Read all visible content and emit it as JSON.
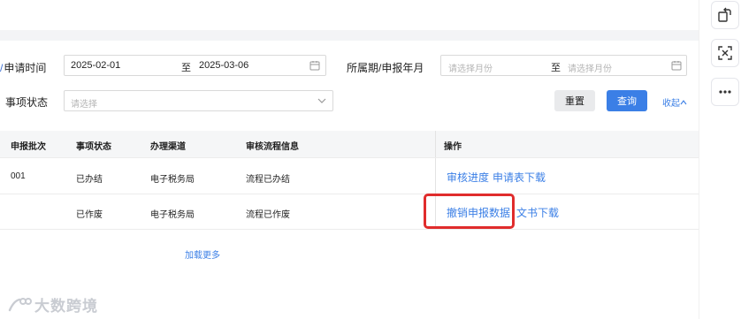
{
  "filters": {
    "apply_time": {
      "label": "申请时间",
      "start": "2025-02-01",
      "separator": "至",
      "end": "2025-03-06"
    },
    "period": {
      "label": "所属期/申报年月",
      "start_placeholder": "请选择月份",
      "separator": "至",
      "end_placeholder": "请选择月份"
    },
    "status": {
      "label": "事项状态",
      "placeholder": "请选择"
    },
    "reset_label": "重置",
    "query_label": "查询",
    "collapse_label": "收起"
  },
  "table": {
    "headers": [
      "申报批次",
      "事项状态",
      "办理渠道",
      "审核流程信息",
      "操作"
    ],
    "rows": [
      {
        "batch": "001",
        "status": "已办结",
        "channel": "电子税务局",
        "flow": "流程已办结",
        "actions": [
          "审核进度",
          "申请表下载"
        ]
      },
      {
        "batch": "",
        "status": "已作废",
        "channel": "电子税务局",
        "flow": "流程已作废",
        "actions": [
          "撤销申报数据",
          "文书下载"
        ]
      }
    ],
    "load_more": "加载更多"
  },
  "watermark": {
    "text": "大数跨境"
  },
  "colors": {
    "accent": "#3b7fe6",
    "highlight": "#e02c2c"
  },
  "icons": {
    "right_toolbar": [
      "rotate-icon",
      "scan-icon",
      "more-icon"
    ]
  }
}
